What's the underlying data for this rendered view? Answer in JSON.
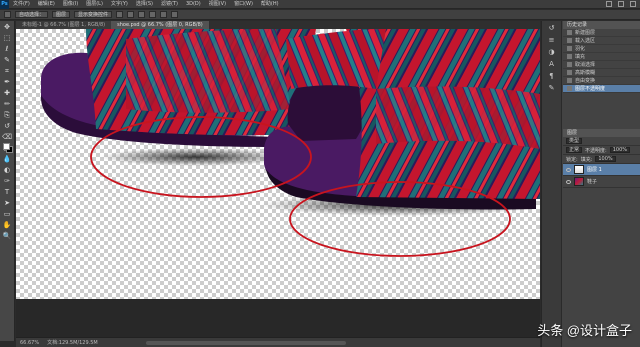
{
  "app": {
    "logo": "Ps"
  },
  "menu": [
    "文件(F)",
    "编辑(E)",
    "图像(I)",
    "图层(L)",
    "文字(Y)",
    "选择(S)",
    "滤镜(T)",
    "3D(D)",
    "视图(V)",
    "窗口(W)",
    "帮助(H)"
  ],
  "options_bar": {
    "mode_label": "自动选择：",
    "mode_value": "图层",
    "show_transform": "显示变换控件"
  },
  "tabs": [
    {
      "label": "未标题-1 @ 66.7% (图层 1, RGB/8)"
    },
    {
      "label": "shoe.psd @ 66.7% (图层 0, RGB/8)"
    }
  ],
  "toolbar": {
    "tools": [
      "move-icon",
      "marquee-icon",
      "lasso-icon",
      "quick-select-icon",
      "crop-icon",
      "eyedropper-icon",
      "heal-icon",
      "brush-icon",
      "stamp-icon",
      "history-brush-icon",
      "eraser-icon",
      "gradient-icon",
      "blur-icon",
      "dodge-icon",
      "pen-icon",
      "type-icon",
      "path-select-icon",
      "shape-icon",
      "hand-icon",
      "zoom-icon"
    ]
  },
  "tool_glyphs": [
    "✥",
    "⬚",
    "ℓ",
    "✎",
    "⌗",
    "✒",
    "✚",
    "✏",
    "⎘",
    "↺",
    "⌫",
    "▤",
    "💧",
    "◐",
    "✑",
    "T",
    "➤",
    "▭",
    "✋",
    "🔍"
  ],
  "status": {
    "zoom": "66.67%",
    "doc": "文档:129.5M/129.5M"
  },
  "history": {
    "tab": "历史记录",
    "items": [
      "新建图层",
      "载入选区",
      "羽化",
      "填充",
      "取消选择",
      "高斯模糊",
      "自由变换",
      "图层不透明度"
    ],
    "active_index": 7
  },
  "layers": {
    "tab": "图层",
    "kind": "类型",
    "blend": "正常",
    "opacity_label": "不透明度:",
    "opacity": "100%",
    "lock_label": "锁定:",
    "fill_label": "填充:",
    "fill": "100%",
    "items": [
      {
        "name": "图层 1",
        "thumb": "shadow",
        "active": true
      },
      {
        "name": "鞋子",
        "thumb": "shoe",
        "active": false
      }
    ]
  },
  "annotation": {
    "color": "#c8141e"
  },
  "watermark": "头条 @设计盒子"
}
